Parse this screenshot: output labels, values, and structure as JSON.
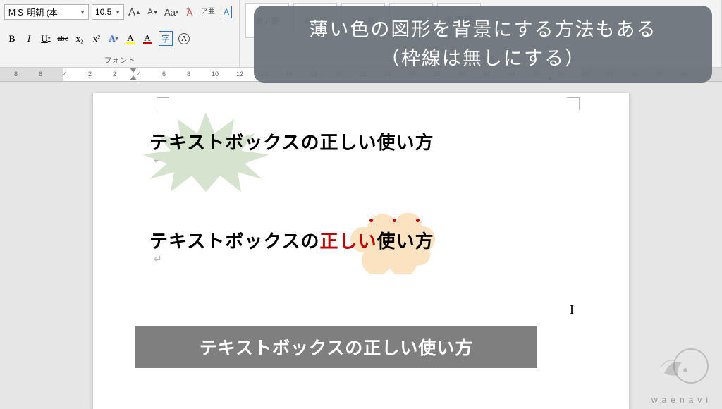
{
  "ribbon": {
    "font": {
      "name": "ＭＳ 明朝 (本",
      "size": "10.5",
      "group_label": "フォント",
      "grow": "A",
      "shrink": "A",
      "case": "Aa",
      "clear": "A",
      "ruby": "ア亜",
      "bold": "B",
      "italic": "I",
      "underline": "U",
      "strike": "abc",
      "sub": "x₂",
      "sup": "x²",
      "texteffect": "A",
      "highlight": "A",
      "fontcolor": "A",
      "charborder": "字",
      "encircle": "A"
    },
    "styles": {
      "group_label": "スタイル",
      "sample_main": "あア亜",
      "sample_large": "あア亜",
      "items": [
        "標準",
        "見出し1",
        "見出し2",
        "表題",
        "副題"
      ]
    }
  },
  "ruler": {
    "nums": [
      "8",
      "6",
      "4",
      "2",
      "2",
      "4",
      "6",
      "8",
      "10",
      "12",
      "14",
      "16",
      "18",
      "20",
      "22",
      "24",
      "26",
      "28",
      "30",
      "32",
      "34",
      "36",
      "38",
      "40",
      "40",
      "40",
      "40",
      "40"
    ]
  },
  "overlay": {
    "line1": "薄い色の図形を背景にする方法もある",
    "line2": "（枠線は無しにする）"
  },
  "doc": {
    "ex1": "テキストボックスの正しい使い方",
    "ex2_pre": "テキストボックスの",
    "ex2_em": "正しい",
    "ex2_post": "使い方",
    "ex3": "テキストボックスの正しい使い方",
    "para": "↵"
  },
  "watermark": {
    "text": "waenavi"
  }
}
